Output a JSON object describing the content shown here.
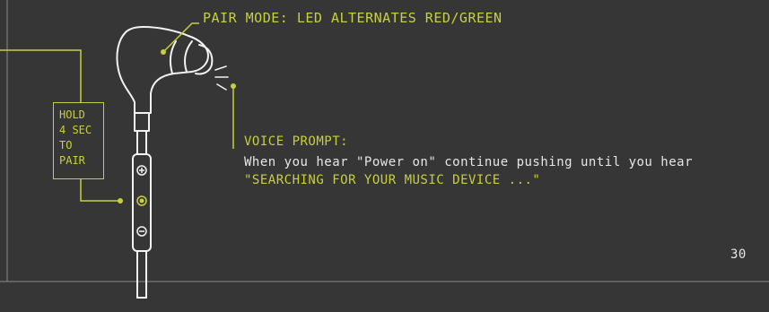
{
  "pair_mode_title": "PAIR MODE: LED ALTERNATES RED/GREEN",
  "hold_box": {
    "line1": "HOLD",
    "line2": "4 SEC",
    "line3": "TO",
    "line4": "PAIR"
  },
  "voice_prompt": {
    "label": "VOICE PROMPT:",
    "line1": "When you hear \"Power on\" continue pushing until you hear",
    "line2": "\"SEARCHING FOR YOUR MUSIC DEVICE ...\""
  },
  "page_number": "30",
  "colors": {
    "background": "#363636",
    "accent": "#c8cf3e",
    "text": "#e6e6e6",
    "outline": "#f2f2f2"
  }
}
